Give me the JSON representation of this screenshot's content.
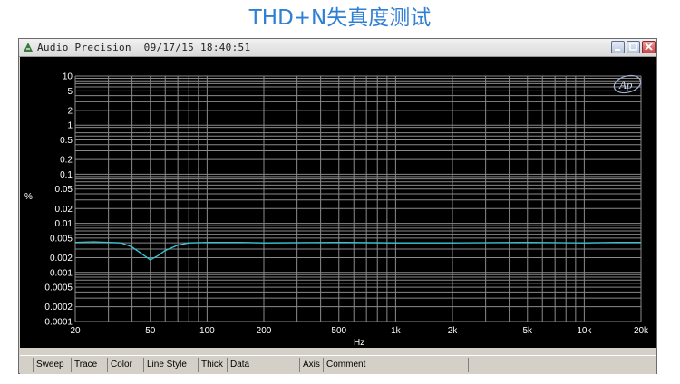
{
  "banner": {
    "title": "THD+N失真度测试"
  },
  "window": {
    "title": "Audio Precision  09/17/15 18:40:51",
    "buttons": [
      "minimize-icon",
      "maximize-icon",
      "close-icon"
    ]
  },
  "logo": {
    "text": "Ap"
  },
  "tabs": [
    "Sweep",
    "Trace",
    "Color",
    "Line Style",
    "Thick",
    "Data",
    "Axis",
    "Comment"
  ],
  "colors": {
    "background": "#000000",
    "grid": "#8a8a8a",
    "trace": "#33c9d6",
    "text": "#ffffff"
  },
  "chart_data": {
    "type": "line",
    "title": "",
    "xlabel": "Hz",
    "ylabel": "%",
    "xscale": "log",
    "yscale": "log",
    "xlim": [
      20,
      20000
    ],
    "ylim": [
      0.0001,
      10
    ],
    "grid": true,
    "xticks": [
      20,
      50,
      100,
      200,
      500,
      1000,
      2000,
      5000,
      10000,
      20000
    ],
    "xtick_labels": [
      "20",
      "50",
      "100",
      "200",
      "500",
      "1k",
      "2k",
      "5k",
      "10k",
      "20k"
    ],
    "yticks": [
      10,
      5,
      2,
      1,
      0.5,
      0.2,
      0.1,
      0.05,
      0.02,
      0.01,
      0.005,
      0.002,
      0.001,
      0.0005,
      0.0002,
      0.0001
    ],
    "ytick_labels": [
      "10",
      "5",
      "2",
      "1",
      "0.5",
      "0.2",
      "0.1",
      "0.05",
      "0.02",
      "0.01",
      "0.005",
      "0.002",
      "0.001",
      "0.0005",
      "0.0002",
      "0.0001"
    ],
    "series": [
      {
        "x": [
          20,
          25,
          30,
          35,
          40,
          45,
          50,
          55,
          60,
          70,
          80,
          100,
          150,
          200,
          500,
          1000,
          2000,
          5000,
          10000,
          15000,
          20000
        ],
        "y": [
          0.0041,
          0.0042,
          0.0041,
          0.004,
          0.0033,
          0.0024,
          0.0018,
          0.0022,
          0.0028,
          0.0036,
          0.004,
          0.0041,
          0.0041,
          0.004,
          0.0041,
          0.004,
          0.004,
          0.0041,
          0.004,
          0.0041,
          0.0041
        ]
      }
    ]
  }
}
